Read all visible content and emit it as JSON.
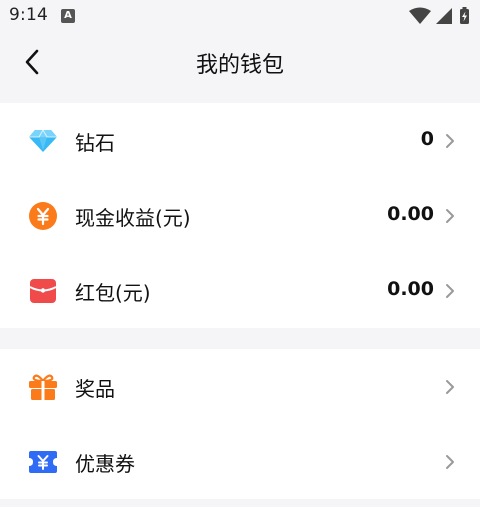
{
  "status_bar": {
    "time": "9:14",
    "notification_badge": "A"
  },
  "header": {
    "title": "我的钱包"
  },
  "wallet_items": [
    {
      "label": "钻石",
      "value": "0",
      "icon": "diamond-icon",
      "color": "#36b9f5"
    },
    {
      "label": "现金收益(元)",
      "value": "0.00",
      "icon": "yuan-coin-icon",
      "color": "#fb7a1a"
    },
    {
      "label": "红包(元)",
      "value": "0.00",
      "icon": "red-envelope-icon",
      "color": "#f04a4a"
    }
  ],
  "extra_items": [
    {
      "label": "奖品",
      "icon": "gift-icon",
      "color": "#fb7a1a"
    },
    {
      "label": "优惠券",
      "icon": "coupon-icon",
      "color": "#2f6bf5"
    }
  ]
}
